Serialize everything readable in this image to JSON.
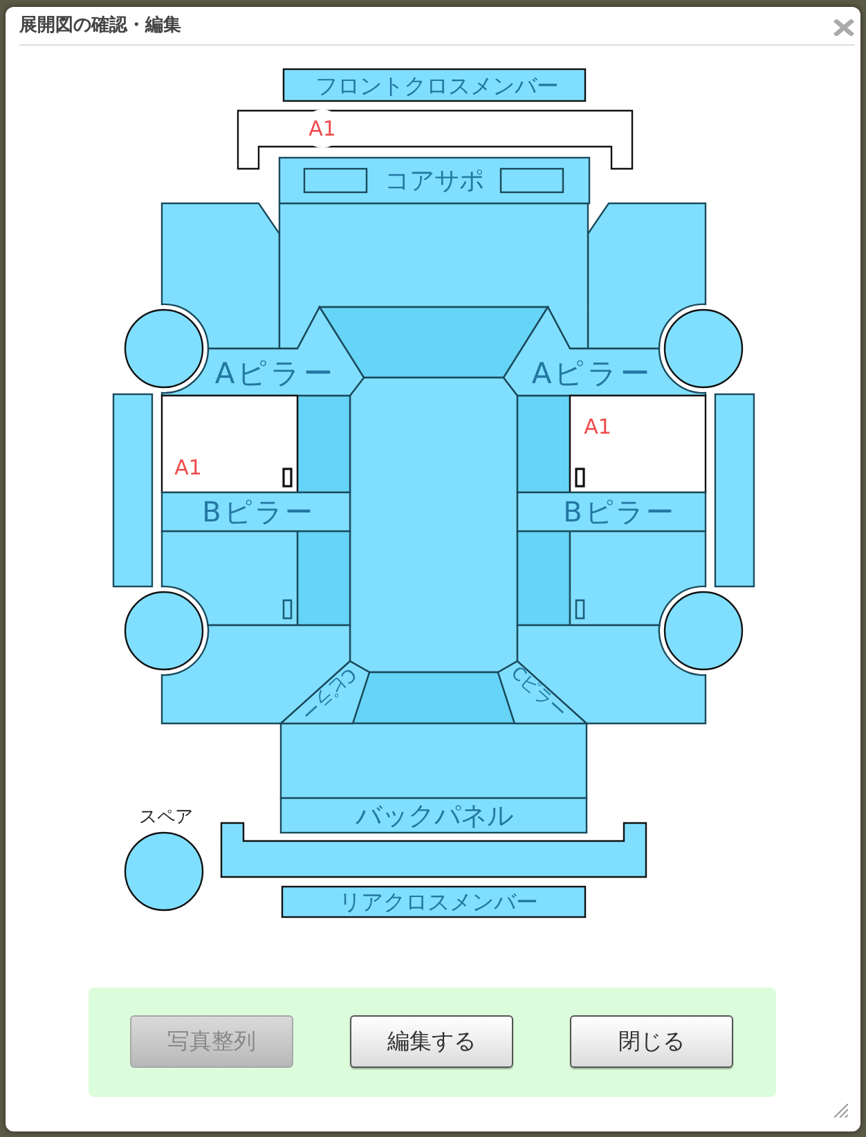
{
  "dialog": {
    "title": "展開図の確認・編集"
  },
  "diagram": {
    "parts": [
      {
        "label": "フロントクロスメンバー"
      },
      {
        "mark": "A1"
      },
      {
        "label": "コアサポ"
      },
      {
        "label": "Aピラー"
      },
      {
        "label": "Aピラー"
      },
      {
        "mark": "A1"
      },
      {
        "mark": "A1"
      },
      {
        "label": "Bピラー"
      },
      {
        "label": "Bピラー"
      },
      {
        "label": "Cピラー"
      },
      {
        "label": "Cピラー"
      },
      {
        "label": "バックパネル"
      },
      {
        "label": "スペア"
      },
      {
        "label": "リアクロスメンバー"
      }
    ]
  },
  "buttons": [
    {
      "label": "写真整列",
      "disabled": true
    },
    {
      "label": "編集する",
      "disabled": false
    },
    {
      "label": "閉じる",
      "disabled": false
    }
  ]
}
